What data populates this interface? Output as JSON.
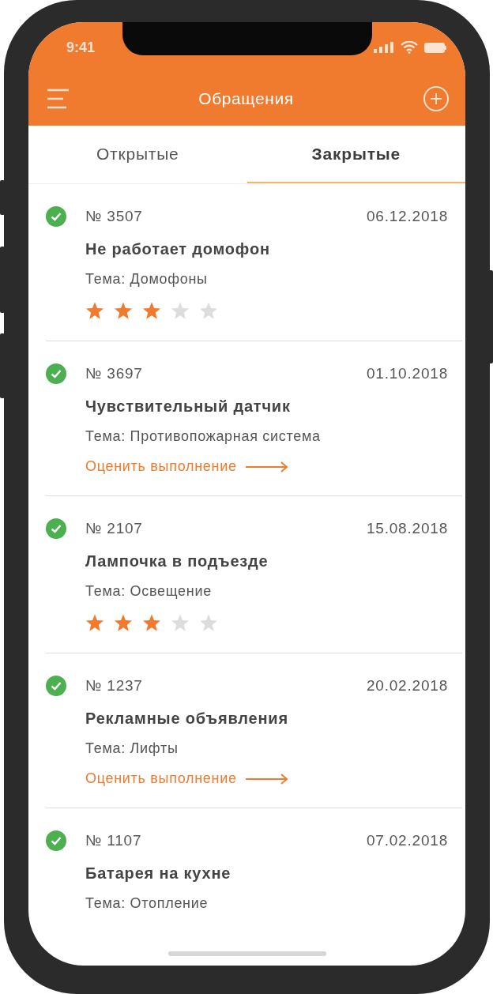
{
  "status_bar": {
    "time": "9:41"
  },
  "header": {
    "title": "Обращения"
  },
  "tabs": [
    {
      "label": "Открытые",
      "selected": false
    },
    {
      "label": "Закрытые",
      "selected": true
    }
  ],
  "tickets": [
    {
      "kind": "rated",
      "number": "№ 3507",
      "date": "06.12.2018",
      "title": "Не работает домофон",
      "topic": "Тема: Домофоны",
      "stars": 3
    },
    {
      "kind": "rate_link",
      "number": "№ 3697",
      "date": "01.10.2018",
      "title": "Чувствительный датчик",
      "topic": "Тема: Противопожарная система",
      "action": "Оценить выполнение"
    },
    {
      "kind": "rated",
      "number": "№ 2107",
      "date": "15.08.2018",
      "title": "Лампочка в подъезде",
      "topic": "Тема: Освещение",
      "stars": 3
    },
    {
      "kind": "rate_link",
      "number": "№ 1237",
      "date": "20.02.2018",
      "title": "Рекламные объявления",
      "topic": "Тема: Лифты",
      "action": "Оценить выполнение"
    },
    {
      "kind": "plain",
      "number": "№ 1107",
      "date": "07.02.2018",
      "title": "Батарея на кухне",
      "topic": "Тема: Отопление"
    }
  ]
}
